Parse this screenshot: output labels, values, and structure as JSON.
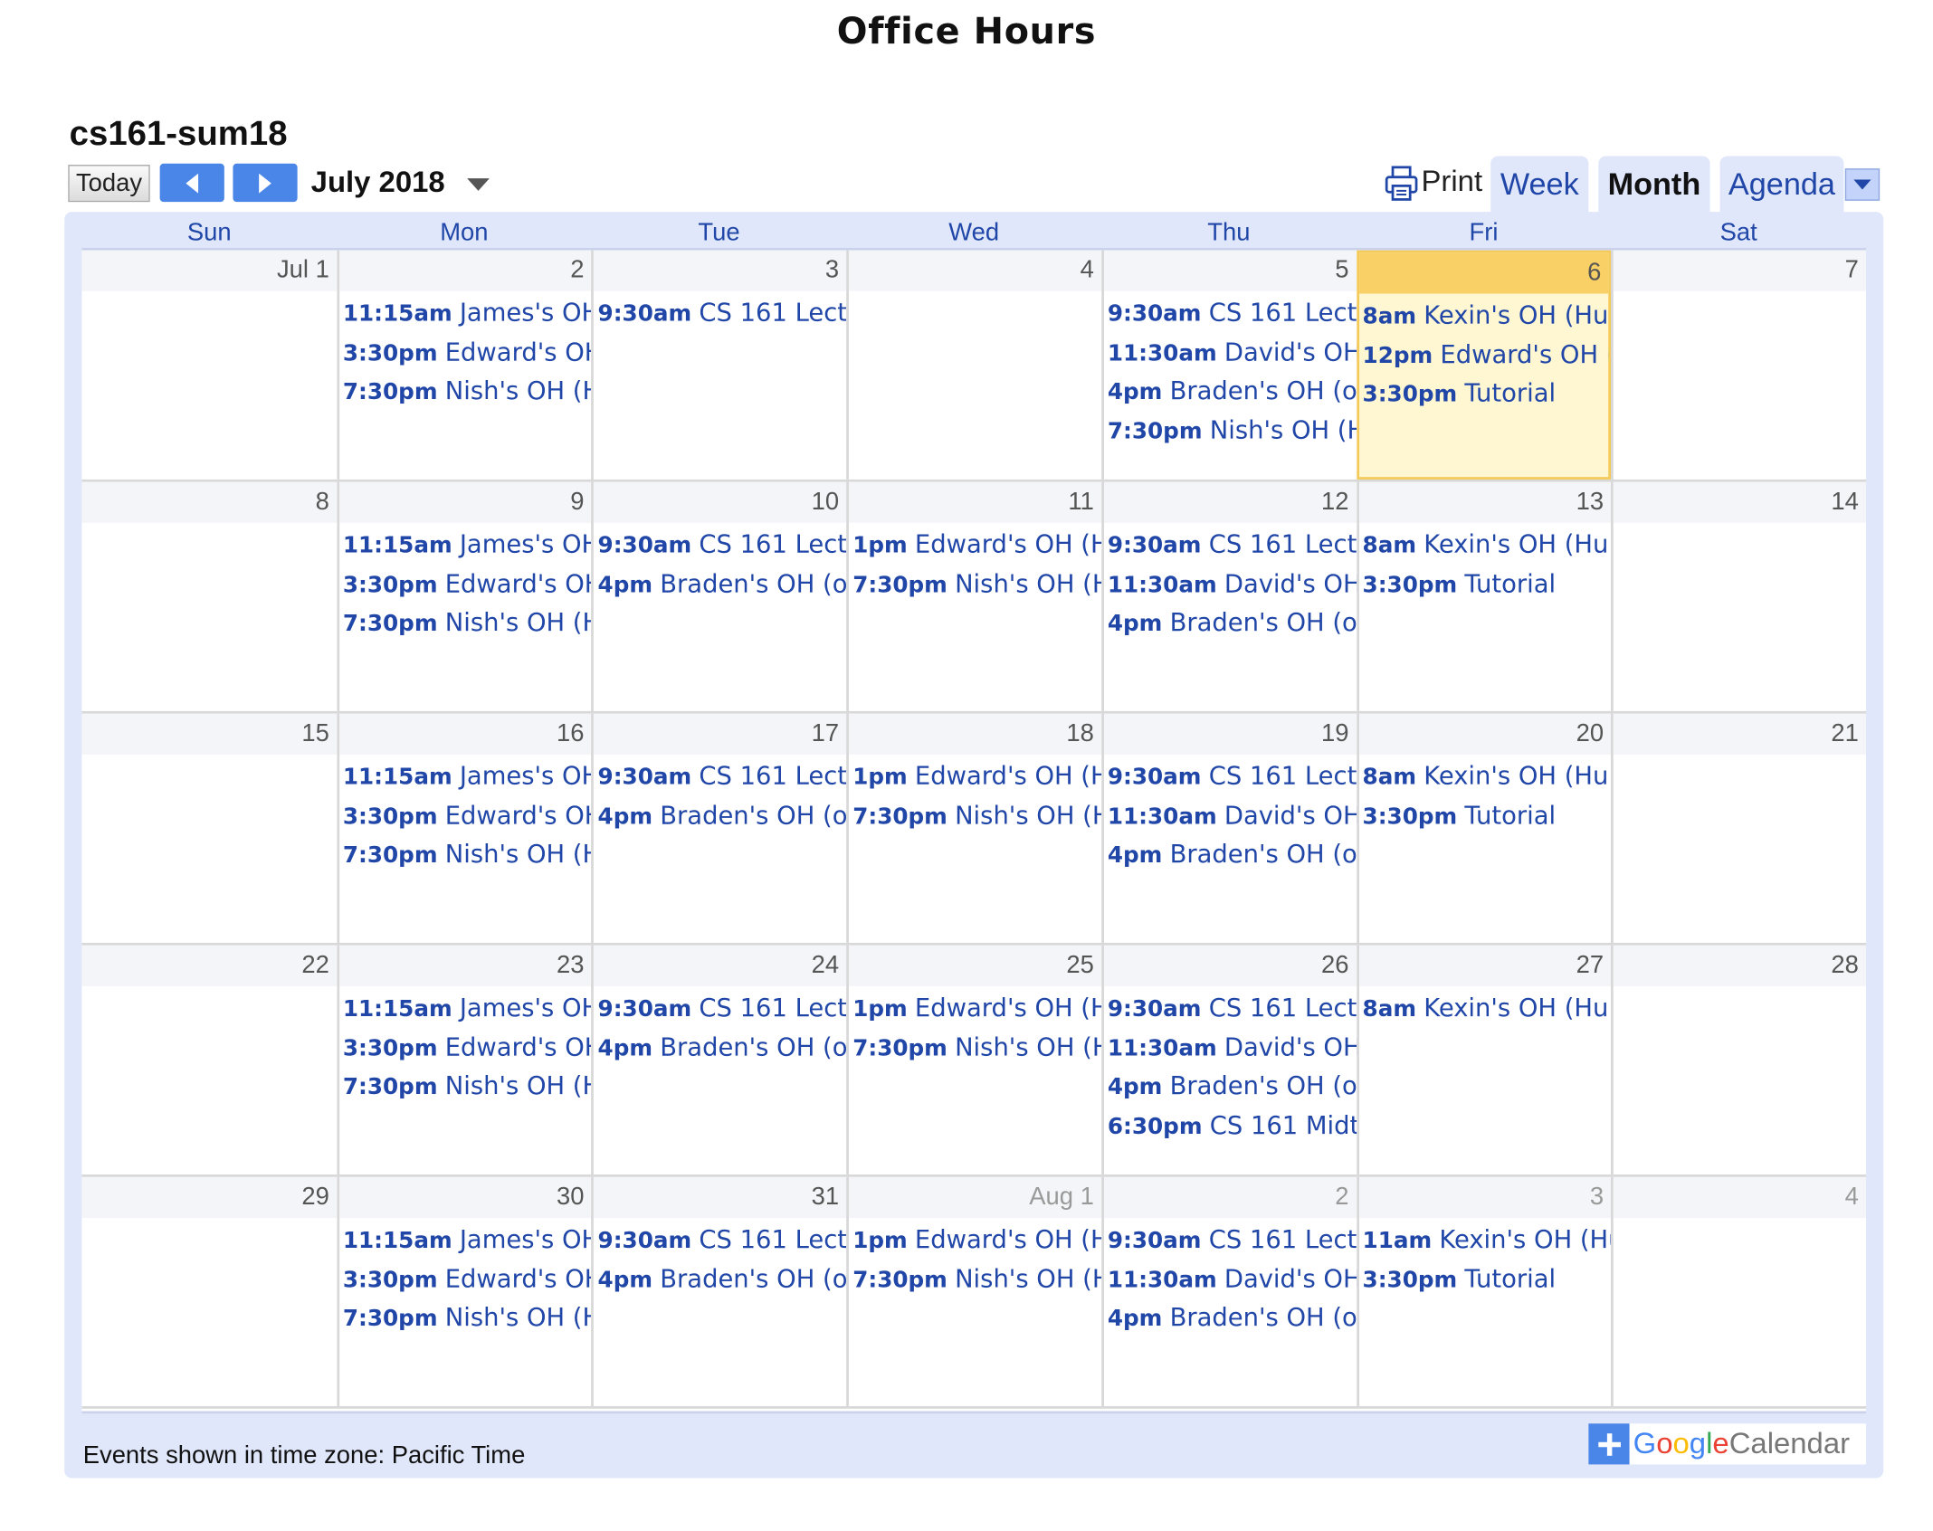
{
  "page_title": "Office Hours",
  "calendar_name": "cs161-sum18",
  "toolbar": {
    "today_label": "Today",
    "month_label": "July 2018",
    "print_label": "Print",
    "tabs": [
      "Week",
      "Month",
      "Agenda"
    ],
    "active_tab": "Month"
  },
  "weekday_headers": [
    "Sun",
    "Mon",
    "Tue",
    "Wed",
    "Thu",
    "Fri",
    "Sat"
  ],
  "weeks": [
    {
      "days": [
        {
          "label": "Jul 1",
          "events": []
        },
        {
          "label": "2",
          "events": [
            {
              "time": "11:15am",
              "title": "James's OH"
            },
            {
              "time": "3:30pm",
              "title": "Edward's OH"
            },
            {
              "time": "7:30pm",
              "title": "Nish's OH (H"
            }
          ]
        },
        {
          "label": "3",
          "events": [
            {
              "time": "9:30am",
              "title": "CS 161 Lectu"
            }
          ]
        },
        {
          "label": "4",
          "events": []
        },
        {
          "label": "5",
          "events": [
            {
              "time": "9:30am",
              "title": "CS 161 Lectu"
            },
            {
              "time": "11:30am",
              "title": "David's OH"
            },
            {
              "time": "4pm",
              "title": "Braden's OH (o"
            },
            {
              "time": "7:30pm",
              "title": "Nish's OH (H"
            }
          ]
        },
        {
          "label": "6",
          "today": true,
          "events": [
            {
              "time": "8am",
              "title": "Kexin's OH (Hu"
            },
            {
              "time": "12pm",
              "title": "Edward's OH ("
            },
            {
              "time": "3:30pm",
              "title": "Tutorial"
            }
          ]
        },
        {
          "label": "7",
          "events": []
        }
      ]
    },
    {
      "days": [
        {
          "label": "8",
          "events": []
        },
        {
          "label": "9",
          "events": [
            {
              "time": "11:15am",
              "title": "James's OH"
            },
            {
              "time": "3:30pm",
              "title": "Edward's OH"
            },
            {
              "time": "7:30pm",
              "title": "Nish's OH (H"
            }
          ]
        },
        {
          "label": "10",
          "events": [
            {
              "time": "9:30am",
              "title": "CS 161 Lectu"
            },
            {
              "time": "4pm",
              "title": "Braden's OH (o"
            }
          ]
        },
        {
          "label": "11",
          "events": [
            {
              "time": "1pm",
              "title": "Edward's OH (H"
            },
            {
              "time": "7:30pm",
              "title": "Nish's OH (H"
            }
          ]
        },
        {
          "label": "12",
          "events": [
            {
              "time": "9:30am",
              "title": "CS 161 Lectu"
            },
            {
              "time": "11:30am",
              "title": "David's OH"
            },
            {
              "time": "4pm",
              "title": "Braden's OH (o"
            }
          ]
        },
        {
          "label": "13",
          "events": [
            {
              "time": "8am",
              "title": "Kexin's OH (Hu"
            },
            {
              "time": "3:30pm",
              "title": "Tutorial"
            }
          ]
        },
        {
          "label": "14",
          "events": []
        }
      ]
    },
    {
      "days": [
        {
          "label": "15",
          "events": []
        },
        {
          "label": "16",
          "events": [
            {
              "time": "11:15am",
              "title": "James's OH"
            },
            {
              "time": "3:30pm",
              "title": "Edward's OH"
            },
            {
              "time": "7:30pm",
              "title": "Nish's OH (H"
            }
          ]
        },
        {
          "label": "17",
          "events": [
            {
              "time": "9:30am",
              "title": "CS 161 Lectu"
            },
            {
              "time": "4pm",
              "title": "Braden's OH (o"
            }
          ]
        },
        {
          "label": "18",
          "events": [
            {
              "time": "1pm",
              "title": "Edward's OH (H"
            },
            {
              "time": "7:30pm",
              "title": "Nish's OH (H"
            }
          ]
        },
        {
          "label": "19",
          "events": [
            {
              "time": "9:30am",
              "title": "CS 161 Lectu"
            },
            {
              "time": "11:30am",
              "title": "David's OH"
            },
            {
              "time": "4pm",
              "title": "Braden's OH (o"
            }
          ]
        },
        {
          "label": "20",
          "events": [
            {
              "time": "8am",
              "title": "Kexin's OH (Hu"
            },
            {
              "time": "3:30pm",
              "title": "Tutorial"
            }
          ]
        },
        {
          "label": "21",
          "events": []
        }
      ]
    },
    {
      "days": [
        {
          "label": "22",
          "events": []
        },
        {
          "label": "23",
          "events": [
            {
              "time": "11:15am",
              "title": "James's OH"
            },
            {
              "time": "3:30pm",
              "title": "Edward's OH"
            },
            {
              "time": "7:30pm",
              "title": "Nish's OH (H"
            }
          ]
        },
        {
          "label": "24",
          "events": [
            {
              "time": "9:30am",
              "title": "CS 161 Lectu"
            },
            {
              "time": "4pm",
              "title": "Braden's OH (o"
            }
          ]
        },
        {
          "label": "25",
          "events": [
            {
              "time": "1pm",
              "title": "Edward's OH (H"
            },
            {
              "time": "7:30pm",
              "title": "Nish's OH (H"
            }
          ]
        },
        {
          "label": "26",
          "events": [
            {
              "time": "9:30am",
              "title": "CS 161 Lectu"
            },
            {
              "time": "11:30am",
              "title": "David's OH"
            },
            {
              "time": "4pm",
              "title": "Braden's OH (o"
            },
            {
              "time": "6:30pm",
              "title": "CS 161 Midte"
            }
          ]
        },
        {
          "label": "27",
          "events": [
            {
              "time": "8am",
              "title": "Kexin's OH (Hu"
            }
          ]
        },
        {
          "label": "28",
          "events": []
        }
      ]
    },
    {
      "days": [
        {
          "label": "29",
          "events": []
        },
        {
          "label": "30",
          "events": [
            {
              "time": "11:15am",
              "title": "James's OH"
            },
            {
              "time": "3:30pm",
              "title": "Edward's OH"
            },
            {
              "time": "7:30pm",
              "title": "Nish's OH (H"
            }
          ]
        },
        {
          "label": "31",
          "events": [
            {
              "time": "9:30am",
              "title": "CS 161 Lectu"
            },
            {
              "time": "4pm",
              "title": "Braden's OH (o"
            }
          ]
        },
        {
          "label": "Aug 1",
          "other_month": true,
          "events": [
            {
              "time": "1pm",
              "title": "Edward's OH (H"
            },
            {
              "time": "7:30pm",
              "title": "Nish's OH (H"
            }
          ]
        },
        {
          "label": "2",
          "other_month": true,
          "events": [
            {
              "time": "9:30am",
              "title": "CS 161 Lectu"
            },
            {
              "time": "11:30am",
              "title": "David's OH"
            },
            {
              "time": "4pm",
              "title": "Braden's OH (o"
            }
          ]
        },
        {
          "label": "3",
          "other_month": true,
          "events": [
            {
              "time": "11am",
              "title": "Kexin's OH (Hu"
            },
            {
              "time": "3:30pm",
              "title": "Tutorial"
            }
          ]
        },
        {
          "label": "4",
          "other_month": true,
          "events": []
        }
      ]
    }
  ],
  "footer": {
    "timezone_text": "Events shown in time zone: Pacific Time",
    "gcal_google": "Google",
    "gcal_calendar": "Calendar"
  },
  "colors": {
    "accent": "#4a86e8",
    "link": "#2046a8",
    "frame": "#e0e7fb",
    "today_bg": "#fff7d1",
    "today_border": "#f4cb5b"
  }
}
